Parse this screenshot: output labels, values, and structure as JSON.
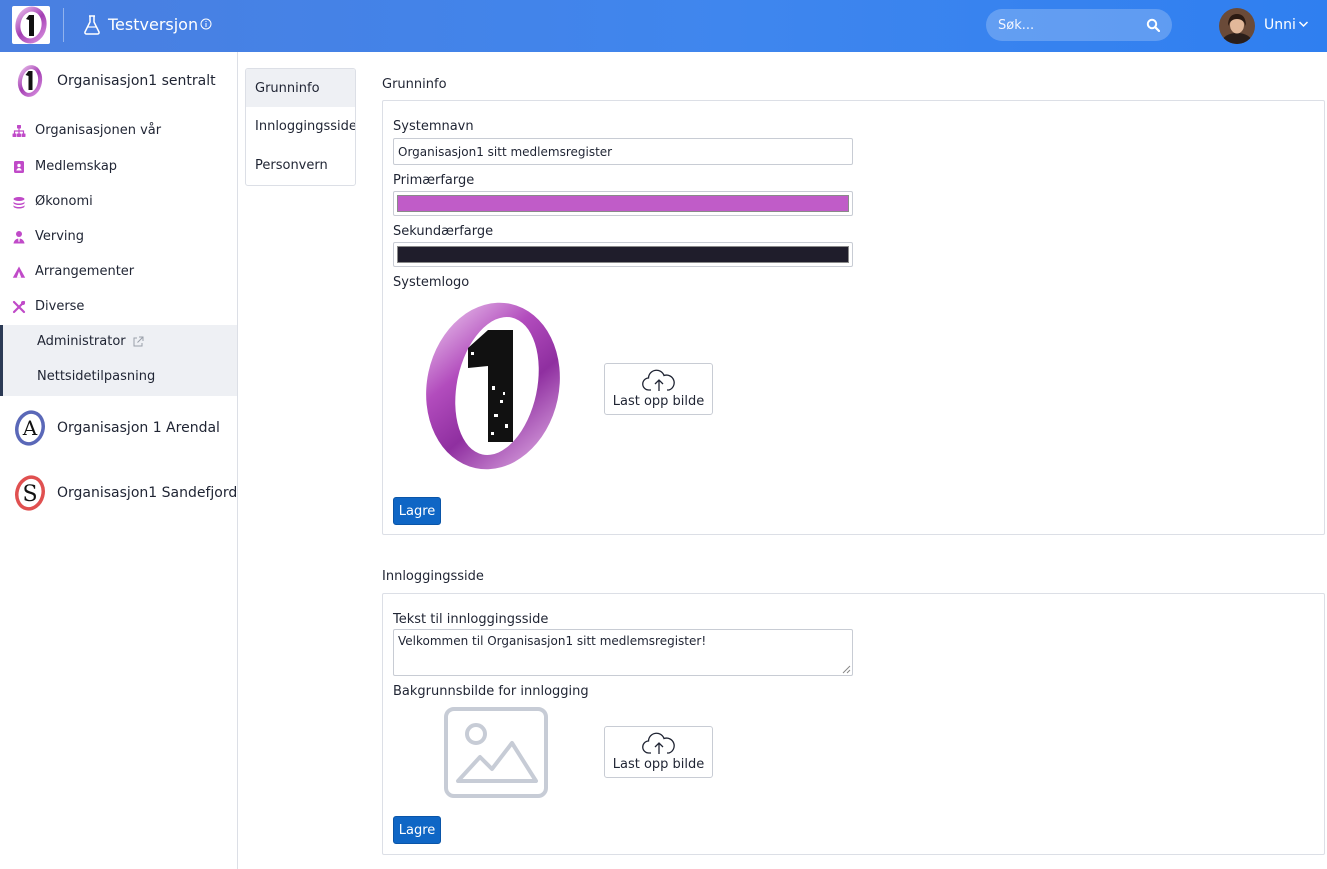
{
  "header": {
    "env_label": "Testversjon",
    "search_placeholder": "Søk...",
    "user_name": "Unni",
    "brand_color": "#3f86ee"
  },
  "sidebar": {
    "orgs": [
      {
        "name": "Organisasjon1 sentralt",
        "logo_letter": "1"
      },
      {
        "name": "Organisasjon 1 Arendal",
        "logo_letter": "A"
      },
      {
        "name": "Organisasjon1 Sandefjord",
        "logo_letter": "S"
      }
    ],
    "items": [
      {
        "label": "Organisasjonen vår",
        "icon": "sitemap-icon"
      },
      {
        "label": "Medlemskap",
        "icon": "id-card-icon"
      },
      {
        "label": "Økonomi",
        "icon": "coins-icon"
      },
      {
        "label": "Verving",
        "icon": "user-tie-icon"
      },
      {
        "label": "Arrangementer",
        "icon": "tent-icon"
      },
      {
        "label": "Diverse",
        "icon": "tools-icon"
      }
    ],
    "sub_items": [
      {
        "label": "Administrator",
        "external": true
      },
      {
        "label": "Nettsidetilpasning",
        "external": false
      }
    ],
    "accent_color": "#c04ac8"
  },
  "tabs": [
    {
      "label": "Grunninfo",
      "active": true
    },
    {
      "label": "Innloggingsside",
      "active": false
    },
    {
      "label": "Personvern",
      "active": false
    }
  ],
  "grunninfo": {
    "title": "Grunninfo",
    "system_name_label": "Systemnavn",
    "system_name_value": "Organisasjon1 sitt medlemsregister",
    "primary_color_label": "Primærfarge",
    "primary_color": "#c05cc8",
    "secondary_color_label": "Sekundærfarge",
    "secondary_color": "#1f1d2b",
    "logo_label": "Systemlogo",
    "upload_label": "Last opp bilde",
    "save_label": "Lagre"
  },
  "login": {
    "title": "Innloggingsside",
    "text_label": "Tekst til innloggingsside",
    "text_value": "Velkommen til Organisasjon1 sitt medlemsregister!",
    "bg_label": "Bakgrunnsbilde for innlogging",
    "upload_label": "Last opp bilde",
    "save_label": "Lagre"
  }
}
